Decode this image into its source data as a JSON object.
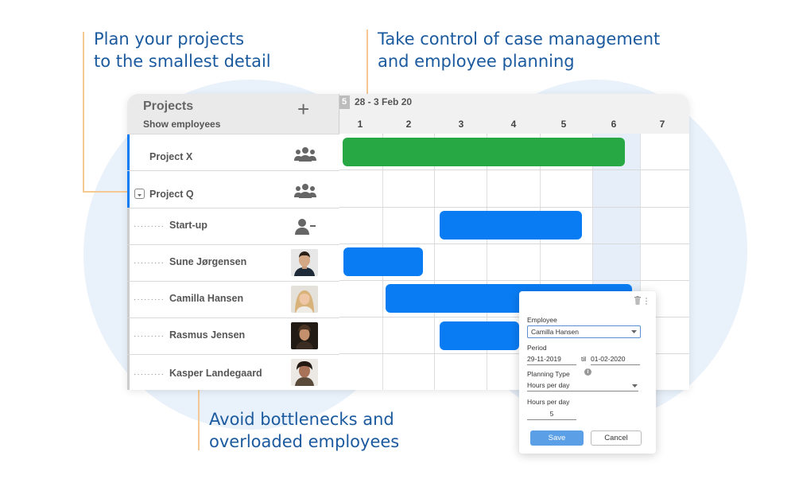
{
  "callouts": {
    "top_left_1": "Plan your projects",
    "top_left_2": "to the smallest detail",
    "top_right_1": "Take control of case management",
    "top_right_2": "and employee planning",
    "bottom_1": "Avoid bottlenecks and",
    "bottom_2": "overloaded employees"
  },
  "sidebar": {
    "title": "Projects",
    "subtitle": "Show employees",
    "add_icon": "plus-icon"
  },
  "header": {
    "week_number": "5",
    "week_range": "28 - 3 Feb 20",
    "days": [
      "1",
      "2",
      "3",
      "4",
      "5",
      "6",
      "7"
    ]
  },
  "rows": [
    {
      "label": "Project X",
      "type": "project",
      "icon": "group-icon"
    },
    {
      "label": "Project Q",
      "type": "project",
      "icon": "group-icon",
      "expand_icon": "chevron-down-icon"
    },
    {
      "label": "Start-up",
      "type": "subtask",
      "icon": "remove-user-icon"
    },
    {
      "label": "Sune Jørgensen",
      "type": "employee",
      "icon": "avatar"
    },
    {
      "label": "Camilla Hansen",
      "type": "employee",
      "icon": "avatar"
    },
    {
      "label": "Rasmus Jensen",
      "type": "employee",
      "icon": "avatar"
    },
    {
      "label": "Kasper Landegaard",
      "type": "employee",
      "icon": "avatar"
    }
  ],
  "colors": {
    "project_bar": "#27a844",
    "task_bar": "#0a7cf3",
    "accent_line": "#f5c993",
    "callout_text": "#1b5a9e",
    "selected_row": "#0a7cf3",
    "weekend": "#e5eef9"
  },
  "popup": {
    "employee_label": "Employee",
    "employee_value": "Camilla Hansen",
    "period_label": "Period",
    "period_from": "29-11-2019",
    "period_til": "til",
    "period_to": "01-02-2020",
    "planning_type_label": "Planning Type",
    "planning_type_value": "Hours per day",
    "hours_label": "Hours per day",
    "hours_value": "5",
    "save_label": "Save",
    "cancel_label": "Cancel",
    "trash_icon": "trash-icon",
    "info_icon": "info-icon"
  }
}
